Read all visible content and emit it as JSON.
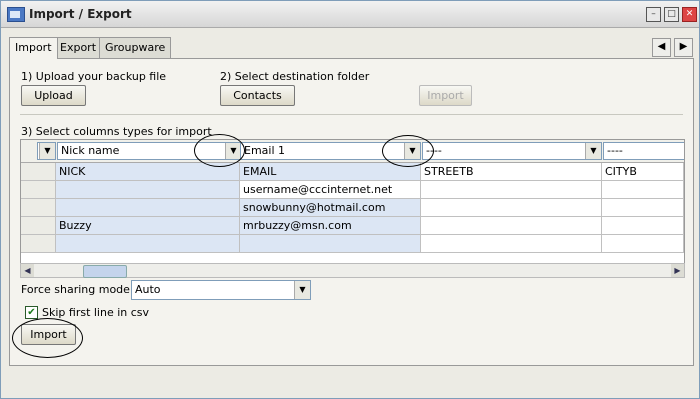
{
  "window": {
    "title": "Import / Export"
  },
  "tabs": [
    {
      "label": "Import"
    },
    {
      "label": "Export"
    },
    {
      "label": "Groupware"
    }
  ],
  "step1": {
    "label": "1) Upload your backup file",
    "button": "Upload"
  },
  "step2": {
    "label": "2) Select destination folder",
    "button": "Contacts",
    "import_disabled": "Import"
  },
  "step3": {
    "label": "3) Select columns types for import"
  },
  "grid": {
    "column_types": [
      "",
      "Nick name",
      "Email 1",
      "----",
      "----"
    ],
    "rows": [
      [
        "",
        "NICK",
        "EMAIL",
        "STREETB",
        "CITYB"
      ],
      [
        "",
        "",
        "username@cccinternet.net",
        "",
        ""
      ],
      [
        "",
        "",
        "snowbunny@hotmail.com",
        "",
        ""
      ],
      [
        "",
        "Buzzy",
        "mrbuzzy@msn.com",
        "",
        ""
      ],
      [
        "",
        "",
        "",
        "",
        ""
      ]
    ]
  },
  "sharing": {
    "label": "Force sharing mode",
    "value": "Auto"
  },
  "skip_first": {
    "label": "Skip first line in csv",
    "checked": true
  },
  "import_button": "Import",
  "icons": {
    "check": "✔",
    "down": "▼",
    "left": "◀",
    "right": "▶",
    "min": "–",
    "max": "□",
    "close": "✕"
  }
}
